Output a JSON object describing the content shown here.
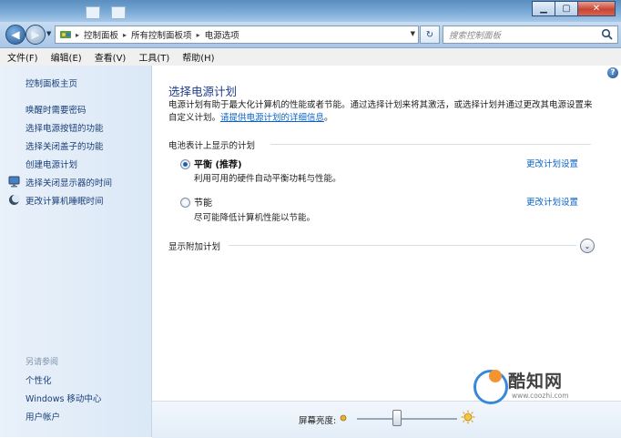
{
  "window": {
    "controls": {
      "minimize": "▁",
      "maximize": "▢",
      "close": "✕"
    }
  },
  "nav": {
    "breadcrumbs": [
      "控制面板",
      "所有控制面板项",
      "电源选项"
    ],
    "search_placeholder": "搜索控制面板",
    "refresh_glyph": "↻"
  },
  "menu": [
    "文件(F)",
    "编辑(E)",
    "查看(V)",
    "工具(T)",
    "帮助(H)"
  ],
  "sidebar": {
    "home": "控制面板主页",
    "links": [
      "唤醒时需要密码",
      "选择电源按钮的功能",
      "选择关闭盖子的功能",
      "创建电源计划",
      "选择关闭显示器的时间",
      "更改计算机睡眠时间"
    ],
    "see_also_title": "另请参阅",
    "see_also": [
      "个性化",
      "Windows 移动中心",
      "用户帐户"
    ]
  },
  "main": {
    "help": "?",
    "title": "选择电源计划",
    "description": "电源计划有助于最大化计算机的性能或者节能。通过选择计划来将其激活，或选择计划并通过更改其电源设置来自定义计划。",
    "description_link": "请提供电源计划的详细信息",
    "description_end": "。",
    "section_title": "电池表计上显示的计划",
    "plans": [
      {
        "name": "平衡 (推荐)",
        "desc": "利用可用的硬件自动平衡功耗与性能。",
        "selected": true,
        "link": "更改计划设置"
      },
      {
        "name": "节能",
        "desc": "尽可能降低计算机性能以节能。",
        "selected": false,
        "link": "更改计划设置"
      }
    ],
    "show_more": "显示附加计划",
    "expand_glyph": "⌄"
  },
  "bottom": {
    "brightness_label": "屏幕亮度:",
    "brightness_level": 0.4
  },
  "watermark": {
    "name": "酷知网",
    "url": "www.coozhi.com"
  },
  "colors": {
    "link": "#0b63c5",
    "title": "#1e3f8a",
    "sidebar_link": "#1a3f78",
    "sidebar_bg": "#e9f1fa"
  }
}
